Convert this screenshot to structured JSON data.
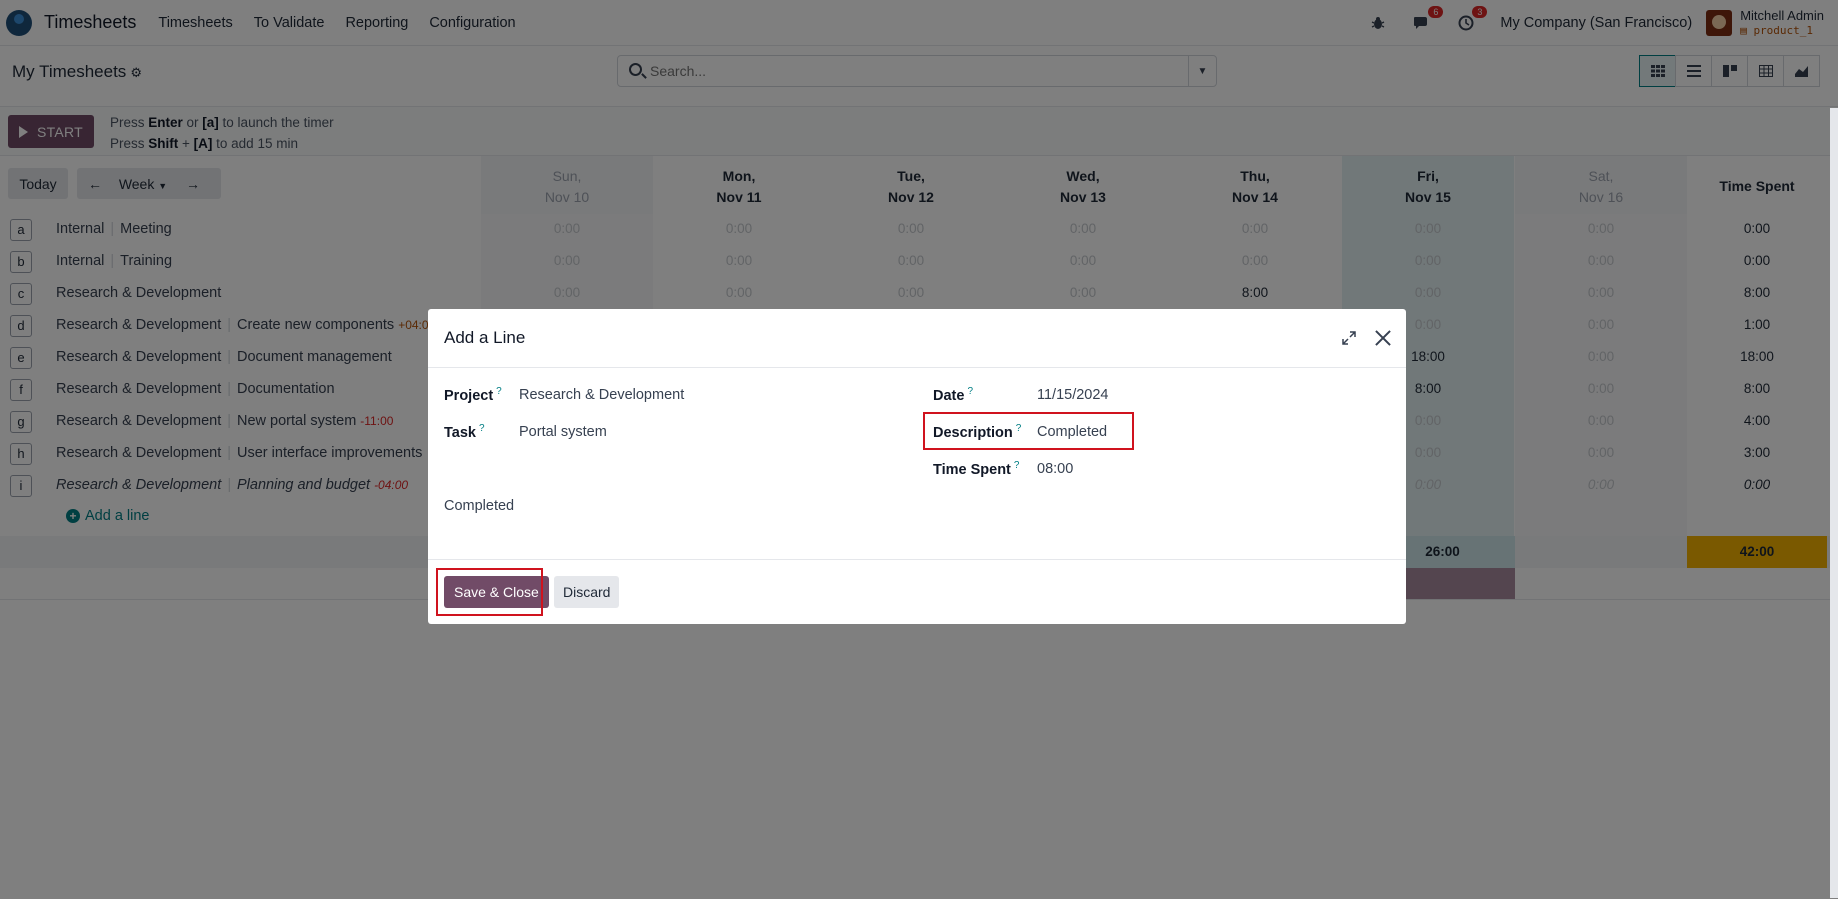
{
  "navbar": {
    "app_name": "Timesheets",
    "menus": [
      "Timesheets",
      "To Validate",
      "Reporting",
      "Configuration"
    ],
    "chat_badge": "6",
    "activity_badge": "3",
    "company": "My Company (San Francisco)",
    "user_name": "Mitchell Admin",
    "database": "product_1"
  },
  "control": {
    "page_title": "My Timesheets",
    "search_placeholder": "Search...",
    "view_icons": [
      "grid-icon",
      "list-icon",
      "kanban-icon",
      "pivot-icon",
      "graph-icon"
    ]
  },
  "timer": {
    "start_label": "START",
    "hint1_pre": "Press ",
    "hint1_key1": "Enter",
    "hint1_mid": " or ",
    "hint1_key2": "[a]",
    "hint1_post": " to launch the timer",
    "hint2_pre": "Press ",
    "hint2_key1": "Shift",
    "hint2_mid": " + ",
    "hint2_key2": "[A]",
    "hint2_post": " to add 15 min"
  },
  "grid": {
    "today_label": "Today",
    "period_label": "Week",
    "days": [
      {
        "dow": "Sun,",
        "date": "Nov 10"
      },
      {
        "dow": "Mon,",
        "date": "Nov 11"
      },
      {
        "dow": "Tue,",
        "date": "Nov 12"
      },
      {
        "dow": "Wed,",
        "date": "Nov 13"
      },
      {
        "dow": "Thu,",
        "date": "Nov 14"
      },
      {
        "dow": "Fri,",
        "date": "Nov 15"
      },
      {
        "dow": "Sat,",
        "date": "Nov 16"
      }
    ],
    "total_header": "Time Spent",
    "rows": [
      {
        "key": "a",
        "project": "Internal",
        "task": "Meeting",
        "extra": "",
        "cells": [
          "0:00",
          "0:00",
          "0:00",
          "0:00",
          "0:00",
          "0:00",
          "0:00"
        ],
        "total": "0:00"
      },
      {
        "key": "b",
        "project": "Internal",
        "task": "Training",
        "extra": "",
        "cells": [
          "0:00",
          "0:00",
          "0:00",
          "0:00",
          "0:00",
          "0:00",
          "0:00"
        ],
        "total": "0:00"
      },
      {
        "key": "c",
        "project": "Research & Development",
        "task": "",
        "extra": "",
        "cells": [
          "0:00",
          "0:00",
          "0:00",
          "0:00",
          "8:00",
          "0:00",
          "0:00"
        ],
        "total": "8:00"
      },
      {
        "key": "d",
        "project": "Research & Development",
        "task": "Create new components",
        "extra": "+04:0",
        "cells": [
          "",
          "",
          "",
          "",
          "",
          "0:00",
          "0:00"
        ],
        "total": "1:00"
      },
      {
        "key": "e",
        "project": "Research & Development",
        "task": "Document management",
        "extra": "",
        "cells": [
          "",
          "",
          "",
          "",
          "",
          "18:00",
          "0:00"
        ],
        "total": "18:00"
      },
      {
        "key": "f",
        "project": "Research & Development",
        "task": "Documentation",
        "extra": "",
        "cells": [
          "",
          "",
          "",
          "",
          "",
          "8:00",
          "0:00"
        ],
        "total": "8:00"
      },
      {
        "key": "g",
        "project": "Research & Development",
        "task": "New portal system",
        "extra": "-11:00",
        "cells": [
          "",
          "",
          "",
          "",
          "",
          "0:00",
          "0:00"
        ],
        "total": "4:00"
      },
      {
        "key": "h",
        "project": "Research & Development",
        "task": "User interface improvements",
        "extra": "",
        "cells": [
          "",
          "",
          "",
          "",
          "",
          "0:00",
          "0:00"
        ],
        "total": "3:00"
      },
      {
        "key": "i",
        "project": "Research & Development",
        "task": "Planning and budget",
        "extra": "-04:00",
        "cells": [
          "",
          "",
          "",
          "",
          "",
          "0:00",
          "0:00"
        ],
        "total": "0:00"
      }
    ],
    "add_line_label": "Add a line",
    "friday_total": "26:00",
    "grand_total": "42:00"
  },
  "dialog": {
    "title": "Add a Line",
    "project_label": "Project",
    "project_value": "Research & Development",
    "task_label": "Task",
    "task_value": "Portal system",
    "date_label": "Date",
    "date_value": "11/15/2024",
    "description_label": "Description",
    "description_value": "Completed",
    "time_spent_label": "Time Spent",
    "time_spent_value": "08:00",
    "note_value": "Completed",
    "help_mark": "?",
    "save_label": "Save & Close",
    "discard_label": "Discard"
  },
  "colors": {
    "brand": "#714b67",
    "accent": "#017e84",
    "highlight": "#d0131e",
    "total_bg": "#f5b300"
  }
}
